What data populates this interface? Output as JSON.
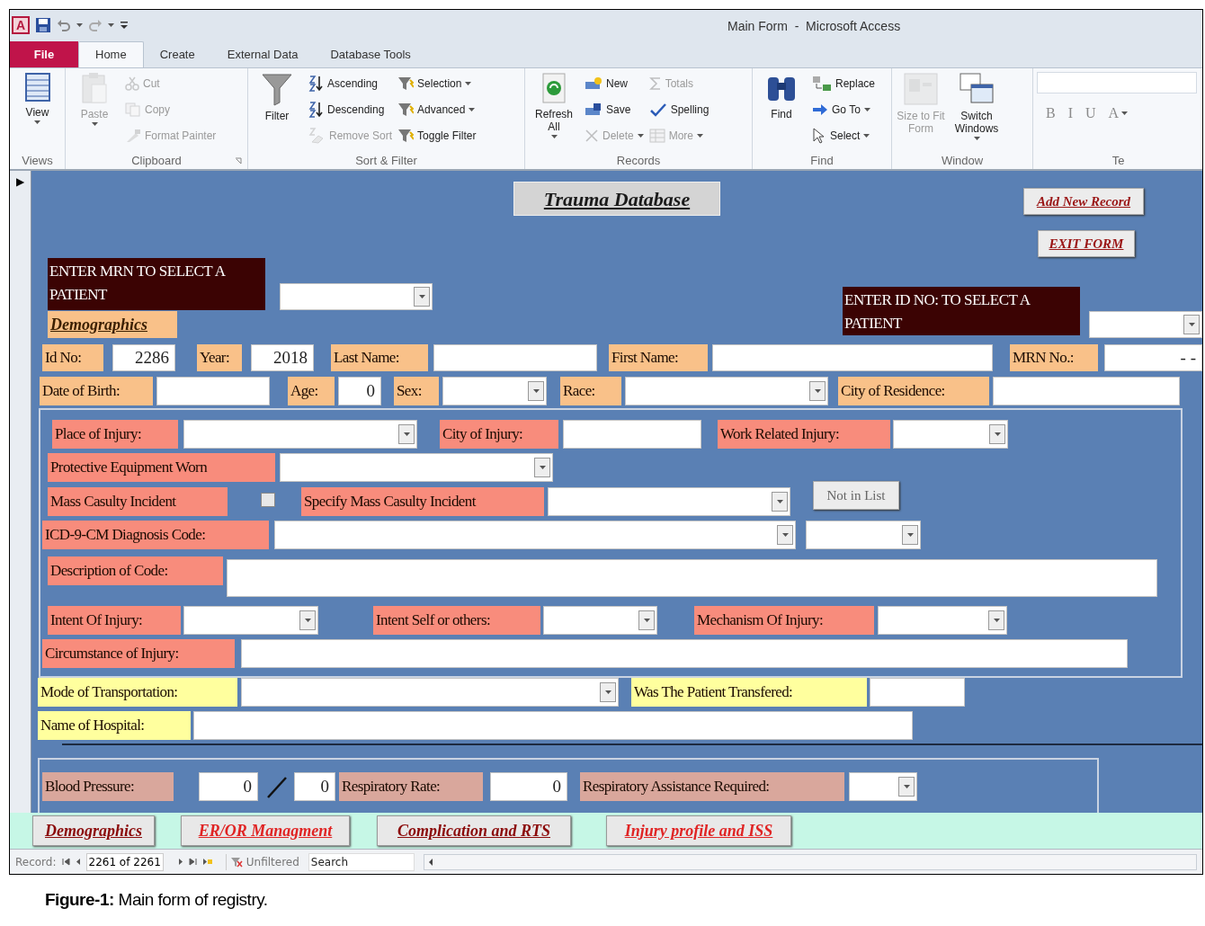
{
  "window": {
    "title": "Main Form  -  Microsoft Access",
    "app_logo": "A"
  },
  "tabs": [
    {
      "kind": "file",
      "label": "File",
      "selected": false
    },
    {
      "kind": "tab",
      "label": "Home",
      "selected": true
    },
    {
      "kind": "tab",
      "label": "Create",
      "selected": false
    },
    {
      "kind": "tab",
      "label": "External Data",
      "selected": false
    },
    {
      "kind": "tab",
      "label": "Database Tools",
      "selected": false
    }
  ],
  "ribbon": [
    {
      "label": "Views",
      "kind": "tools",
      "items": [
        {
          "kind": "large",
          "label": "View",
          "dropdown": true,
          "disabled": false
        }
      ]
    },
    {
      "label": "Clipboard",
      "kind": "tools",
      "launcher": true,
      "items": [
        {
          "kind": "large",
          "label": "Paste",
          "dropdown": true,
          "disabled": true
        },
        {
          "kind": "small",
          "label": "Cut",
          "dropdown": false,
          "disabled": true
        },
        {
          "kind": "small",
          "label": "Copy",
          "dropdown": false,
          "disabled": true
        },
        {
          "kind": "small",
          "label": "Format Painter",
          "dropdown": false,
          "disabled": true
        }
      ]
    },
    {
      "label": "Sort & Filter",
      "kind": "tools",
      "items": [
        {
          "kind": "large",
          "label": "Filter",
          "dropdown": false,
          "disabled": false
        },
        {
          "kind": "small",
          "label": "Ascending",
          "dropdown": false,
          "disabled": false
        },
        {
          "kind": "small",
          "label": "Descending",
          "dropdown": false,
          "disabled": false
        },
        {
          "kind": "small",
          "label": "Remove Sort",
          "dropdown": false,
          "disabled": true
        },
        {
          "kind": "small",
          "label": "Selection",
          "dropdown": true,
          "disabled": false
        },
        {
          "kind": "small",
          "label": "Advanced",
          "dropdown": true,
          "disabled": false
        },
        {
          "kind": "small",
          "label": "Toggle Filter",
          "dropdown": false,
          "disabled": false
        }
      ]
    },
    {
      "label": "Records",
      "kind": "tools",
      "items": [
        {
          "kind": "large",
          "label": "Refresh All",
          "dropdown": true,
          "disabled": false
        },
        {
          "kind": "small",
          "label": "New",
          "dropdown": false,
          "disabled": false
        },
        {
          "kind": "small",
          "label": "Save",
          "dropdown": false,
          "disabled": false
        },
        {
          "kind": "small",
          "label": "Delete",
          "dropdown": true,
          "disabled": true
        },
        {
          "kind": "small",
          "label": "Totals",
          "dropdown": false,
          "disabled": true
        },
        {
          "kind": "small",
          "label": "Spelling",
          "dropdown": false,
          "disabled": false
        },
        {
          "kind": "small",
          "label": "More",
          "dropdown": true,
          "disabled": true
        }
      ]
    },
    {
      "label": "Find",
      "kind": "tools",
      "items": [
        {
          "kind": "large",
          "label": "Find",
          "dropdown": false,
          "disabled": false
        },
        {
          "kind": "small",
          "label": "Replace",
          "dropdown": false,
          "disabled": false
        },
        {
          "kind": "small",
          "label": "Go To",
          "dropdown": true,
          "disabled": false
        },
        {
          "kind": "small",
          "label": "Select",
          "dropdown": true,
          "disabled": false
        }
      ]
    },
    {
      "label": "Window",
      "kind": "tools",
      "items": [
        {
          "kind": "large",
          "label": "Size to Fit Form",
          "dropdown": false,
          "disabled": true
        },
        {
          "kind": "large",
          "label": "Switch Windows",
          "dropdown": true,
          "disabled": false
        }
      ]
    },
    {
      "label": "Te",
      "kind": "format",
      "items": [
        {
          "kind": "glyph",
          "label": "B",
          "dropdown": false,
          "disabled": true
        },
        {
          "kind": "glyph",
          "label": "I",
          "dropdown": false,
          "disabled": true
        },
        {
          "kind": "glyph",
          "label": "U",
          "dropdown": false,
          "disabled": true
        },
        {
          "kind": "glyph",
          "label": "A",
          "dropdown": true,
          "disabled": true
        }
      ]
    }
  ],
  "form": {
    "record_selector": "▶",
    "sections": [
      {
        "kind": "header",
        "controls": [
          {
            "kind": "title",
            "text": "Trauma Database"
          },
          {
            "kind": "button",
            "text": "Add New Record"
          },
          {
            "kind": "button",
            "text": "EXIT FORM"
          },
          {
            "kind": "prompt",
            "text": "ENTER MRN TO SELECT A PATIENT"
          },
          {
            "kind": "combo"
          },
          {
            "kind": "heading",
            "text": "Demographics"
          },
          {
            "kind": "prompt",
            "text": "ENTER ID NO: TO SELECT A PATIENT"
          },
          {
            "kind": "combo"
          }
        ]
      },
      {
        "kind": "demographics",
        "controls": [
          {
            "kind": "label",
            "text": "Id No:"
          },
          {
            "kind": "field",
            "value": "2286"
          },
          {
            "kind": "label",
            "text": "Year:"
          },
          {
            "kind": "field",
            "value": "2018"
          },
          {
            "kind": "label",
            "text": "Last Name:"
          },
          {
            "kind": "field"
          },
          {
            "kind": "label",
            "text": "First Name:"
          },
          {
            "kind": "field"
          },
          {
            "kind": "label",
            "text": "MRN No.:"
          },
          {
            "kind": "field",
            "value": "- -"
          },
          {
            "kind": "label",
            "text": "Date of Birth:"
          },
          {
            "kind": "field"
          },
          {
            "kind": "label",
            "text": "Age:"
          },
          {
            "kind": "field",
            "value": "0"
          },
          {
            "kind": "label",
            "text": "Sex:"
          },
          {
            "kind": "combo"
          },
          {
            "kind": "label",
            "text": "Race:"
          },
          {
            "kind": "combo"
          },
          {
            "kind": "label",
            "text": "City of Residence:"
          },
          {
            "kind": "field"
          }
        ]
      },
      {
        "kind": "injury",
        "controls": [
          {
            "kind": "label",
            "text": "Place of Injury:"
          },
          {
            "kind": "combo"
          },
          {
            "kind": "label",
            "text": "City of Injury:"
          },
          {
            "kind": "field"
          },
          {
            "kind": "label",
            "text": "Work Related Injury:"
          },
          {
            "kind": "combo"
          },
          {
            "kind": "label",
            "text": "Protective Equipment Worn"
          },
          {
            "kind": "combo"
          },
          {
            "kind": "label",
            "text": "Mass Casulty Incident"
          },
          {
            "kind": "checkbox",
            "checked": false
          },
          {
            "kind": "label",
            "text": "Specify Mass Casulty Incident"
          },
          {
            "kind": "combo"
          },
          {
            "kind": "button",
            "text": "Not in List"
          },
          {
            "kind": "label",
            "text": "ICD-9-CM Diagnosis Code:"
          },
          {
            "kind": "combo"
          },
          {
            "kind": "combo"
          },
          {
            "kind": "label",
            "text": "Description of Code:"
          },
          {
            "kind": "field"
          },
          {
            "kind": "label",
            "text": "Intent Of Injury:"
          },
          {
            "kind": "combo"
          },
          {
            "kind": "label",
            "text": "Intent Self or others:"
          },
          {
            "kind": "combo"
          },
          {
            "kind": "label",
            "text": "Mechanism Of Injury:"
          },
          {
            "kind": "combo"
          },
          {
            "kind": "label",
            "text": "Circumstance of Injury:"
          },
          {
            "kind": "field"
          }
        ]
      },
      {
        "kind": "transport",
        "controls": [
          {
            "kind": "label",
            "text": "Mode of Transportation:"
          },
          {
            "kind": "combo"
          },
          {
            "kind": "label",
            "text": "Was The  Patient Transfered:"
          },
          {
            "kind": "field"
          },
          {
            "kind": "label",
            "text": "Name of Hospital:"
          },
          {
            "kind": "field"
          }
        ]
      },
      {
        "kind": "vitals",
        "controls": [
          {
            "kind": "label",
            "text": "Blood Pressure:"
          },
          {
            "kind": "field",
            "value": "0"
          },
          {
            "kind": "field",
            "value": "0"
          },
          {
            "kind": "label",
            "text": "Respiratory Rate:"
          },
          {
            "kind": "field",
            "value": "0"
          },
          {
            "kind": "label",
            "text": "Respiratory Assistance Required:"
          },
          {
            "kind": "combo"
          }
        ]
      }
    ]
  },
  "form_tabs": [
    {
      "label": "Demographics",
      "color": "#8b0a0a"
    },
    {
      "label": "ER/OR Managment",
      "color": "#e02424"
    },
    {
      "label": "Complication and RTS",
      "color": "#8b0a0a"
    },
    {
      "label": "Injury profile and ISS",
      "color": "#e02424"
    }
  ],
  "record_nav": {
    "label": "Record:",
    "position": "2261 of 2261",
    "filter": "Unfiltered",
    "search": {
      "placeholder": "Search"
    }
  },
  "caption": "**Figure-1:** Main form of registry."
}
